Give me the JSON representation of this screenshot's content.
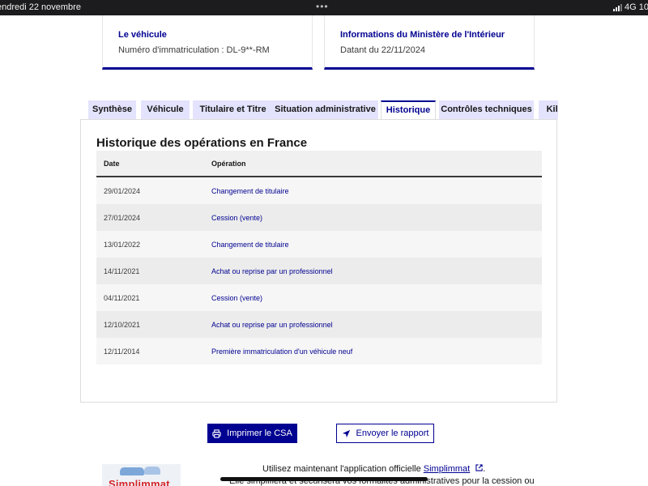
{
  "status_bar": {
    "date": "endredi 22 novembre",
    "dots": "•••",
    "network": "4G 10"
  },
  "cards": {
    "vehicle": {
      "title": "Le véhicule",
      "subtitle": "Numéro d'immatriculation : DL-9**-RM"
    },
    "ministry": {
      "title": "Informations du Ministère de l'Intérieur",
      "subtitle": "Datant du 22/11/2024"
    }
  },
  "tabs": [
    {
      "label": "Synthèse"
    },
    {
      "label": "Véhicule"
    },
    {
      "label": "Titulaire et Titre"
    },
    {
      "label": "Situation administrative"
    },
    {
      "label": "Historique"
    },
    {
      "label": "Contrôles techniques"
    },
    {
      "label": "Kilo"
    }
  ],
  "active_tab": "Historique",
  "history": {
    "title": "Historique des opérations en France",
    "columns": {
      "date": "Date",
      "operation": "Opération"
    },
    "rows": [
      {
        "date": "29/01/2024",
        "operation": "Changement de titulaire"
      },
      {
        "date": "27/01/2024",
        "operation": "Cession (vente)"
      },
      {
        "date": "13/01/2022",
        "operation": "Changement de titulaire"
      },
      {
        "date": "14/11/2021",
        "operation": "Achat ou reprise par un professionnel"
      },
      {
        "date": "04/11/2021",
        "operation": "Cession (vente)"
      },
      {
        "date": "12/10/2021",
        "operation": "Achat ou reprise par un professionnel"
      },
      {
        "date": "12/11/2014",
        "operation": "Première immatriculation d'un véhicule neuf"
      }
    ]
  },
  "actions": {
    "print_label": "Imprimer le CSA",
    "send_label": "Envoyer le rapport"
  },
  "promo": {
    "logo_text": "Simplimmat",
    "line1_prefix": "Utilisez maintenant l'application officielle ",
    "line1_link": "Simplimmat",
    "line1_suffix": ".",
    "line2": "Elle simplifiera et sécurisera vos formalités administratives pour la cession ou"
  },
  "colors": {
    "accent": "#000091",
    "tab_bg": "#e3e3fd",
    "logo_red": "#d6262a"
  }
}
